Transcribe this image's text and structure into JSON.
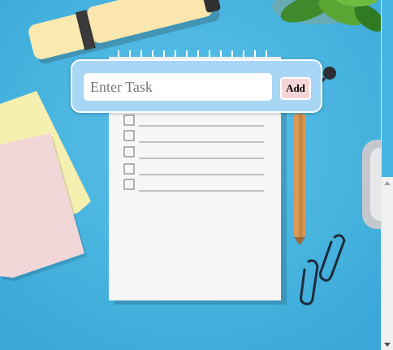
{
  "task_form": {
    "input_placeholder": "Enter Task",
    "input_value": "",
    "add_label": "Add"
  },
  "colors": {
    "background": "#45b6e2",
    "card": "#a8d6f5",
    "add_button": "#f6d5d8"
  },
  "icons": [
    "chevron-up-icon",
    "chevron-down-icon"
  ]
}
